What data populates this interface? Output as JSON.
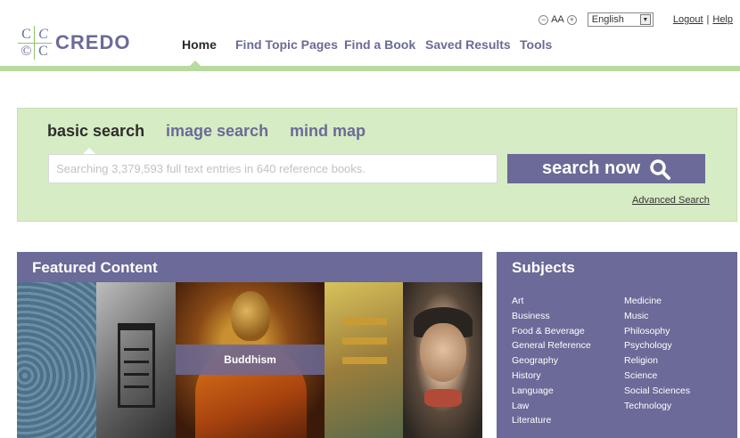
{
  "brand": {
    "name": "CREDO"
  },
  "utility": {
    "font_decrease": "−",
    "font_label": "AA",
    "font_increase": "+",
    "language": "English",
    "logout": "Logout",
    "separator": "|",
    "help": "Help"
  },
  "nav": {
    "items": [
      {
        "label": "Home",
        "active": true
      },
      {
        "label": "Find Topic Pages"
      },
      {
        "label": "Find a Book"
      },
      {
        "label": "Saved Results"
      },
      {
        "label": "Tools"
      }
    ]
  },
  "search": {
    "tabs": [
      {
        "label": "basic search",
        "active": true
      },
      {
        "label": "image search"
      },
      {
        "label": "mind map"
      }
    ],
    "placeholder": "Searching 3,379,593 full text entries in 640 reference books.",
    "button_label": "search now",
    "advanced_link": "Advanced Search"
  },
  "featured": {
    "title": "Featured Content",
    "caption": "Buddhism"
  },
  "subjects": {
    "title": "Subjects",
    "col1": [
      "Art",
      "Business",
      "Food & Beverage",
      "General Reference",
      "Geography",
      "History",
      "Language",
      "Law",
      "Literature"
    ],
    "col2": [
      "Medicine",
      "Music",
      "Philosophy",
      "Psychology",
      "Religion",
      "Science",
      "Social Sciences",
      "Technology"
    ]
  },
  "colors": {
    "brand_purple": "#6b6a98",
    "panel_green": "#d6ecc4",
    "accent_green": "#b7da9e"
  }
}
